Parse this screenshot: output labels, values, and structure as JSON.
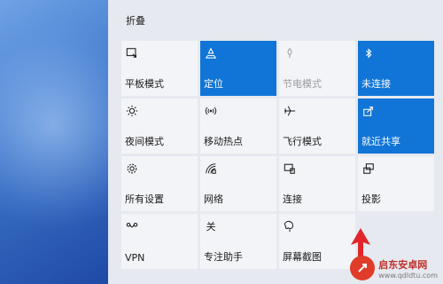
{
  "header": {
    "collapse_label": "折叠"
  },
  "tiles": [
    {
      "label": "平板模式",
      "icon": "tablet-mode-icon",
      "state": "off"
    },
    {
      "label": "定位",
      "icon": "location-icon",
      "state": "on"
    },
    {
      "label": "节电模式",
      "icon": "battery-saver-icon",
      "state": "disabled"
    },
    {
      "label": "未连接",
      "icon": "bluetooth-icon",
      "state": "on"
    },
    {
      "label": "夜间模式",
      "icon": "night-light-icon",
      "state": "off"
    },
    {
      "label": "移动热点",
      "icon": "mobile-hotspot-icon",
      "state": "off"
    },
    {
      "label": "飞行模式",
      "icon": "airplane-icon",
      "state": "off"
    },
    {
      "label": "就近共享",
      "icon": "nearby-share-icon",
      "state": "on"
    },
    {
      "label": "所有设置",
      "icon": "gear-icon",
      "state": "off"
    },
    {
      "label": "网络",
      "icon": "network-icon",
      "state": "off"
    },
    {
      "label": "连接",
      "icon": "connect-icon",
      "state": "off"
    },
    {
      "label": "投影",
      "icon": "project-icon",
      "state": "off"
    },
    {
      "label": "VPN",
      "icon": "vpn-icon",
      "state": "off"
    },
    {
      "label": "专注助手",
      "icon": "focus-assist-icon",
      "state": "off",
      "icon_text": "关"
    },
    {
      "label": "屏幕截图",
      "icon": "screen-snip-icon",
      "state": "off"
    }
  ],
  "watermark": {
    "name": "启东安卓网",
    "url": "www.qdldtu.com"
  },
  "colors": {
    "accent": "#1075d6",
    "tile": "#f3f4f7",
    "panel": "#e6e9f0",
    "arrow": "#e0262a"
  }
}
